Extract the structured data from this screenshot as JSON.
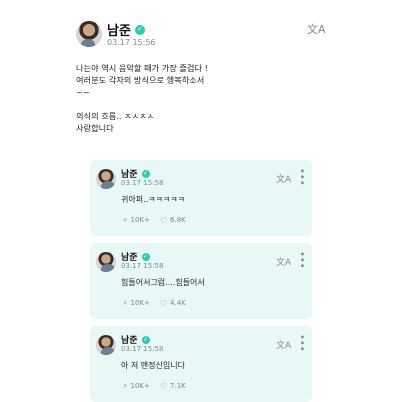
{
  "post": {
    "author": "남준",
    "verified_icon": "verified-check-icon",
    "timestamp": "03.17 15:56",
    "translate_icon": "文A",
    "body": "나는야 역시 음악할 때가 가장 즐겁다 !\n여러분도 각자의 방식으로 행복하소서\n~~\n\n의식의 흐름.. ㅈㅅㅈㅅ\n사랑합니다"
  },
  "replies": [
    {
      "author": "남준",
      "timestamp": "03.17 15:58",
      "translate_icon": "文A",
      "text": "귀아퍼..ㅋㅋㅋㅋㅋ",
      "comments": "10K+",
      "likes": "6.8K"
    },
    {
      "author": "남준",
      "timestamp": "03.17 15:58",
      "translate_icon": "文A",
      "text": "힘들어서그럼....힘들어서",
      "comments": "10K+",
      "likes": "4.4K"
    },
    {
      "author": "남준",
      "timestamp": "03.17 15:58",
      "translate_icon": "文A",
      "text": "아 저 맨정신입니다",
      "comments": "10K+",
      "likes": "7.1K"
    }
  ]
}
